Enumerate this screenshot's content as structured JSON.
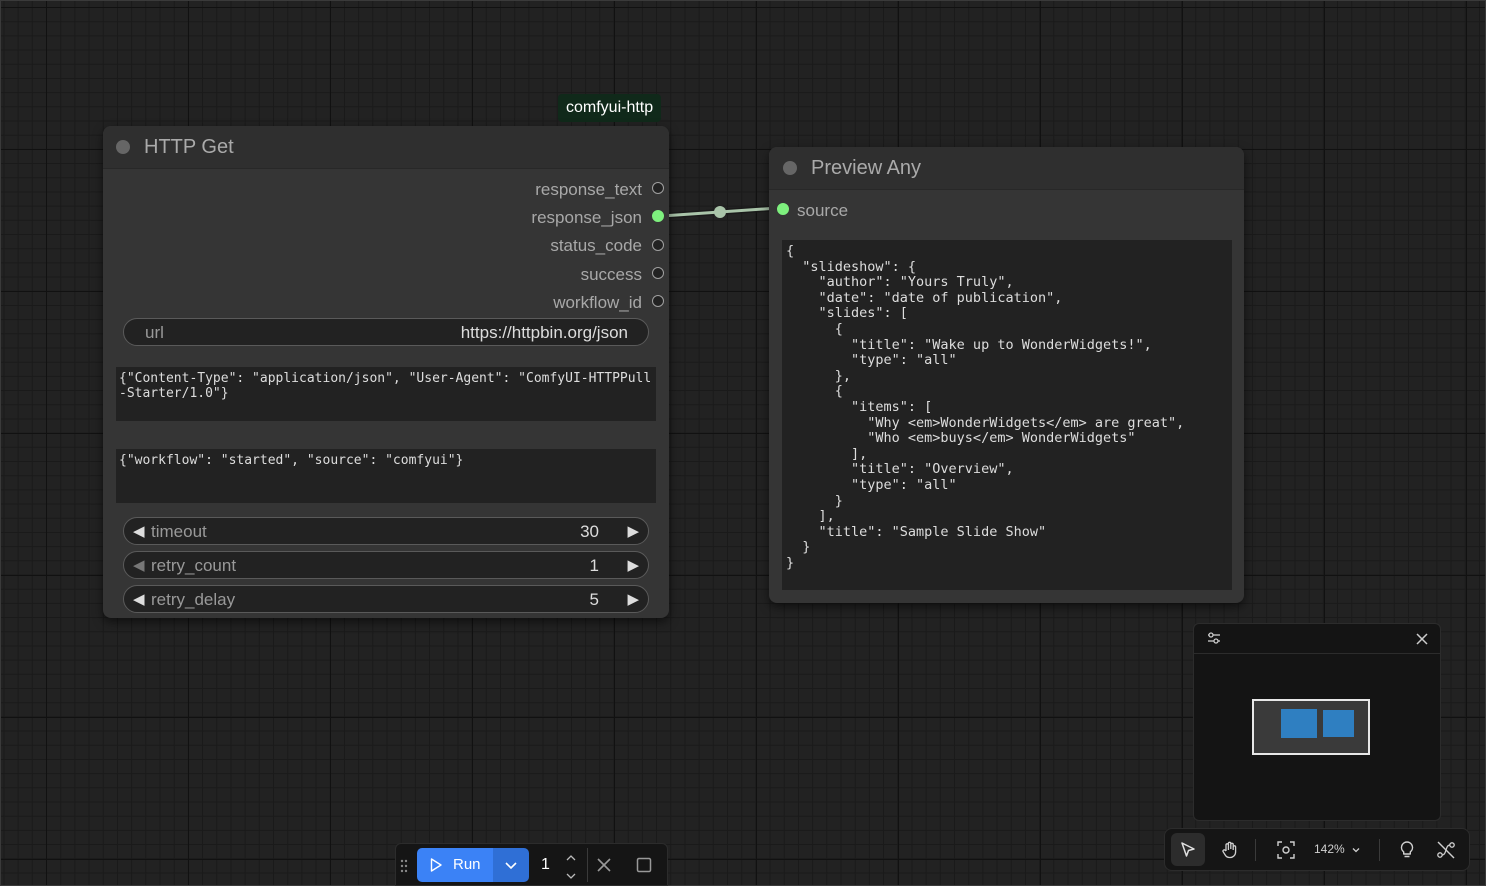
{
  "badge": {
    "text": "comfyui-http"
  },
  "http_get_node": {
    "title": "HTTP Get",
    "outputs": [
      "response_text",
      "response_json",
      "status_code",
      "success",
      "workflow_id"
    ],
    "url": {
      "label": "url",
      "value": "https://httpbin.org/json"
    },
    "headers_text": "{\"Content-Type\": \"application/json\", \"User-Agent\": \"ComfyUI-HTTPPull-Starter/1.0\"}",
    "body_text": "{\"workflow\": \"started\", \"source\": \"comfyui\"}",
    "timeout": {
      "label": "timeout",
      "value": "30"
    },
    "retry_count": {
      "label": "retry_count",
      "value": "1"
    },
    "retry_delay": {
      "label": "retry_delay",
      "value": "5"
    }
  },
  "preview_node": {
    "title": "Preview Any",
    "input_label": "source",
    "content": "{\n  \"slideshow\": {\n    \"author\": \"Yours Truly\",\n    \"date\": \"date of publication\",\n    \"slides\": [\n      {\n        \"title\": \"Wake up to WonderWidgets!\",\n        \"type\": \"all\"\n      },\n      {\n        \"items\": [\n          \"Why <em>WonderWidgets</em> are great\",\n          \"Who <em>buys</em> WonderWidgets\"\n        ],\n        \"title\": \"Overview\",\n        \"type\": \"all\"\n      }\n    ],\n    \"title\": \"Sample Slide Show\"\n  }\n}"
  },
  "toolbar": {
    "zoom": "142%",
    "icons": [
      "select-icon",
      "hand-icon",
      "fit-view-icon",
      "lightbulb-icon",
      "hide-links-icon"
    ]
  },
  "runbar": {
    "run_label": "Run",
    "batch_count": "1"
  },
  "colors": {
    "connected_slot": "#7ef07e",
    "run_button": "#3b82f6",
    "badge_bg": "#10291a",
    "minimap_node": "#2f7fc1"
  }
}
